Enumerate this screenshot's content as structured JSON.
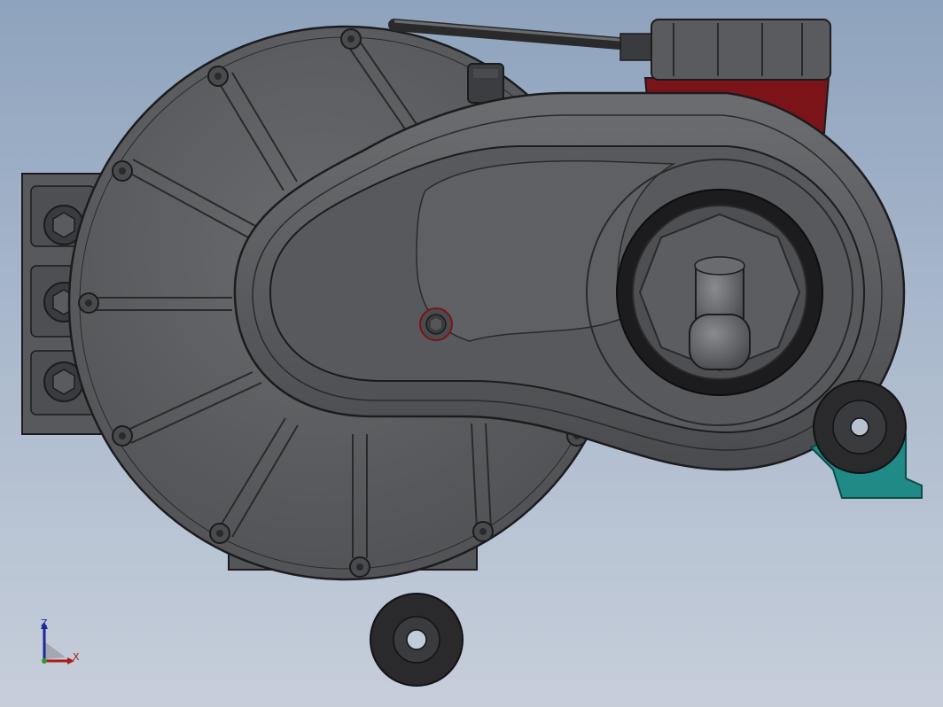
{
  "viewport": {
    "background_top": "#8ea3bd",
    "background_bottom": "#c6ceda"
  },
  "model": {
    "components": [
      "motor-housing",
      "terminal-block",
      "gearbox-cover",
      "output-shaft",
      "vent-plug",
      "cable",
      "junction-box",
      "mounting-bracket",
      "rubber-mount"
    ],
    "colors": {
      "housing": "#5c5d60",
      "edge": "#1c1c1e",
      "junction_red": "#7a1418",
      "bracket_teal": "#1f8a86",
      "rubber": "#2a2a2c"
    }
  },
  "triad": {
    "z_label": "Z",
    "x_label": "X",
    "z_color": "#1a2a9a",
    "x_color": "#b01818"
  }
}
